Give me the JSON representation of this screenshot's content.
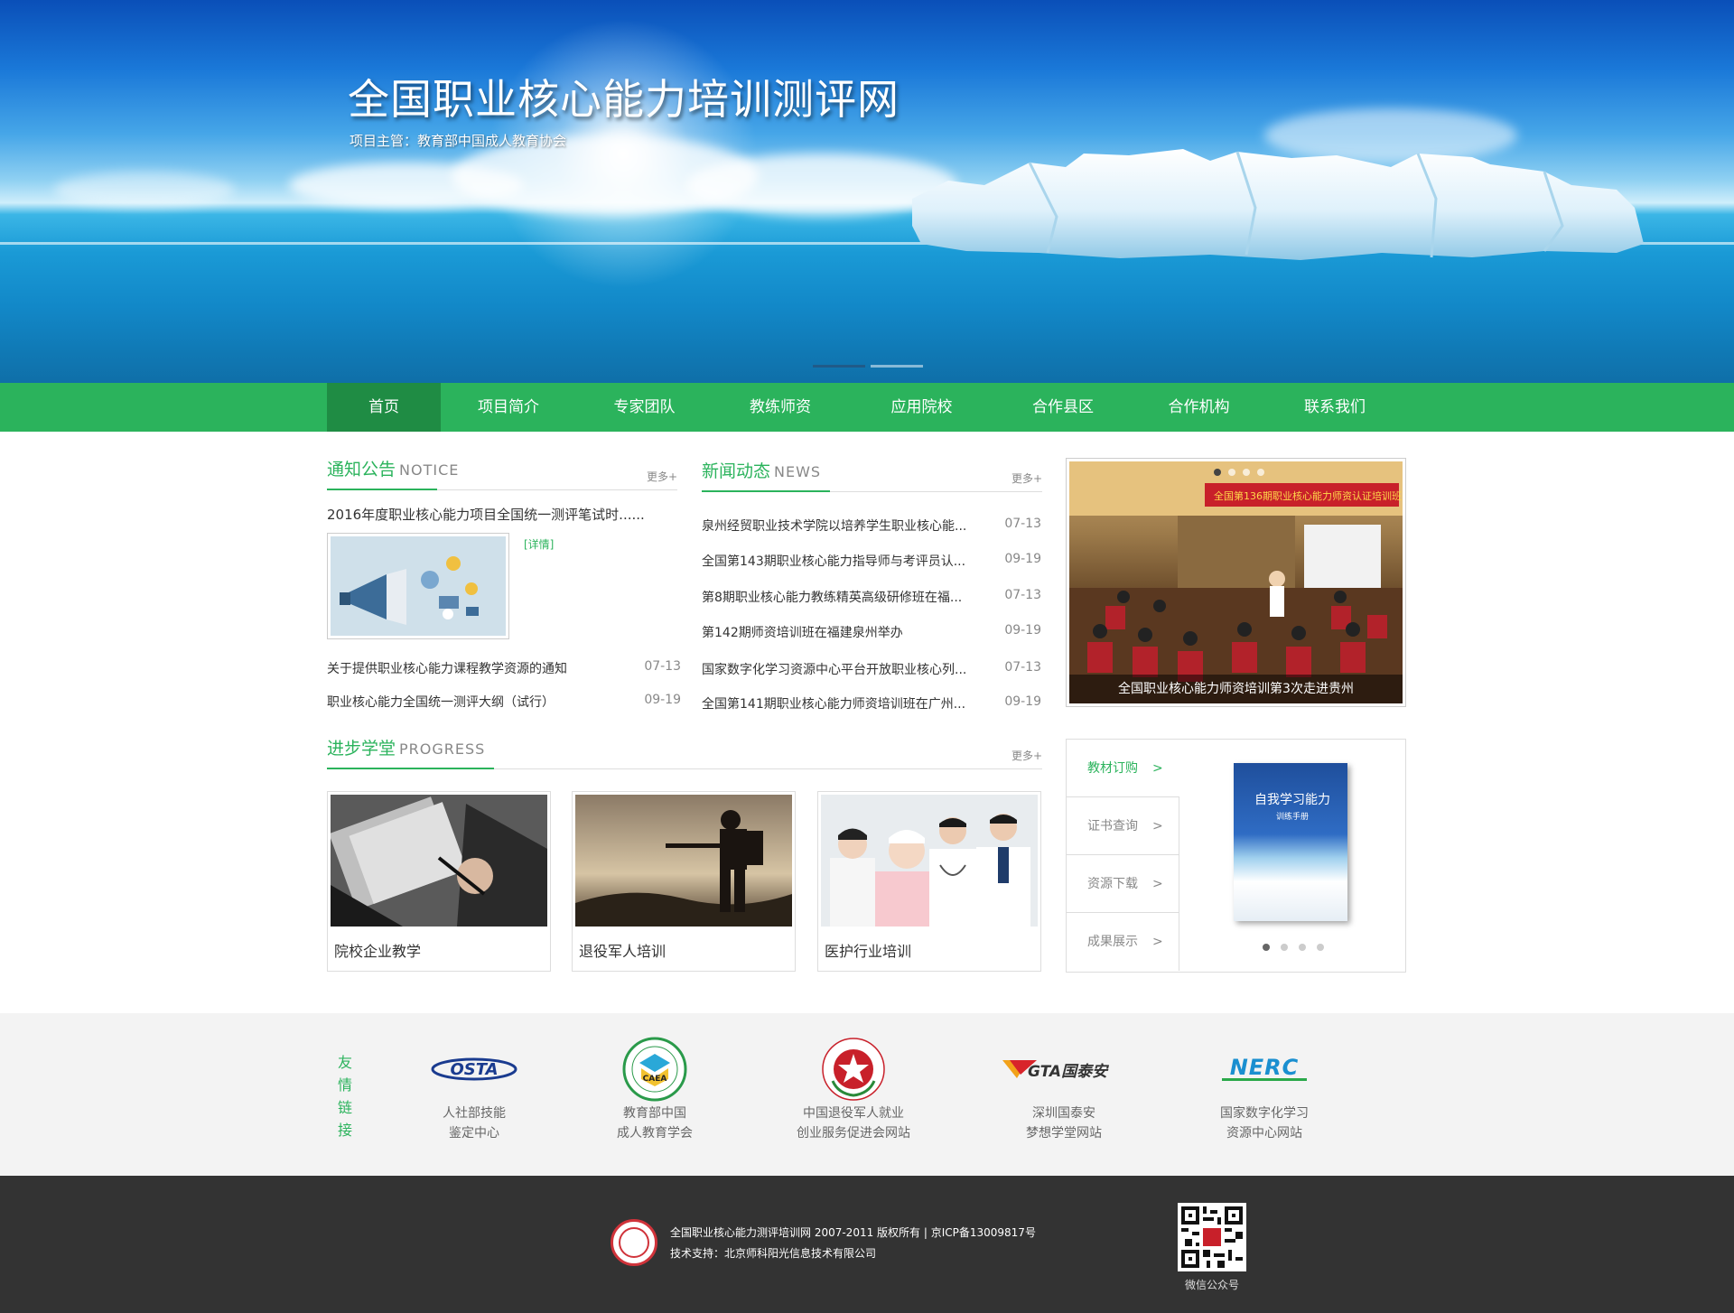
{
  "banner": {
    "title": "全国职业核心能力培训测评网",
    "subtitle": "项目主管：教育部中国成人教育协会"
  },
  "nav": {
    "items": [
      {
        "label": "首页",
        "active": true
      },
      {
        "label": "项目简介"
      },
      {
        "label": "专家团队"
      },
      {
        "label": "教练师资"
      },
      {
        "label": "应用院校"
      },
      {
        "label": "合作县区"
      },
      {
        "label": "合作机构"
      },
      {
        "label": "联系我们"
      }
    ]
  },
  "notice": {
    "title_cn": "通知公告",
    "title_en": "NOTICE",
    "more": "更多+",
    "headline": "2016年度职业核心能力项目全国统一测评笔试时......",
    "detail": "[详情]",
    "items": [
      {
        "title": "关于提供职业核心能力课程教学资源的通知",
        "date": "07-13"
      },
      {
        "title": "职业核心能力全国统一测评大纲（试行）",
        "date": "09-19"
      }
    ]
  },
  "news": {
    "title_cn": "新闻动态",
    "title_en": "NEWS",
    "more": "更多+",
    "items": [
      {
        "title": "泉州经贸职业技术学院以培养学生职业核心能...",
        "date": "07-13"
      },
      {
        "title": "全国第143期职业核心能力指导师与考评员认...",
        "date": "09-19"
      },
      {
        "title": "第8期职业核心能力教练精英高级研修班在福...",
        "date": "07-13"
      },
      {
        "title": "第142期师资培训班在福建泉州举办",
        "date": "09-19"
      },
      {
        "title": "国家数字化学习资源中心平台开放职业核心列...",
        "date": "07-13"
      },
      {
        "title": "全国第141期职业核心能力师资培训班在广州...",
        "date": "09-19"
      }
    ]
  },
  "photo": {
    "caption": "全国职业核心能力师资培训第3次走进贵州",
    "slides": 4,
    "active_slide": 1
  },
  "progress": {
    "title_cn": "进步学堂",
    "title_en": "PROGRESS",
    "more": "更多+",
    "cards": [
      {
        "label": "院校企业教学"
      },
      {
        "label": "退役军人培训"
      },
      {
        "label": "医护行业培训"
      }
    ]
  },
  "side": {
    "menu": [
      {
        "label": "教材订购",
        "arrow": ">",
        "active": true
      },
      {
        "label": "证书查询",
        "arrow": ">"
      },
      {
        "label": "资源下载",
        "arrow": ">"
      },
      {
        "label": "成果展示",
        "arrow": ">"
      }
    ],
    "book_title": "自我学习能力",
    "book_sub": "训练手册",
    "slides": 4,
    "active_slide": 1
  },
  "links": {
    "title": "友情链接",
    "partners": [
      {
        "logo": "OSTA",
        "line1": "人社部技能",
        "line2": "鉴定中心"
      },
      {
        "logo": "CAEA",
        "line1": "教育部中国",
        "line2": "成人教育学会"
      },
      {
        "logo": "star-emblem",
        "line1": "中国退役军人就业",
        "line2": "创业服务促进会网站"
      },
      {
        "logo": "GTA国泰安",
        "line1": "深圳国泰安",
        "line2": "梦想学堂网站"
      },
      {
        "logo": "NERC",
        "line1": "国家数字化学习",
        "line2": "资源中心网站"
      }
    ]
  },
  "footer": {
    "line1": "全国职业核心能力测评培训网 2007-2011 版权所有 | 京ICP备13009817号",
    "line2": "技术支持：北京师科阳光信息技术有限公司",
    "qr_label": "微信公众号"
  },
  "colors": {
    "accent": "#2bb35c",
    "nav_active": "#1f8c44",
    "footer": "#333333",
    "links_bg": "#f3f3f3"
  }
}
